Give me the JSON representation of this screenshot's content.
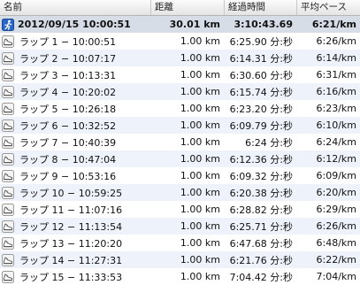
{
  "header": {
    "name": "名前",
    "distance": "距離",
    "elapsed": "経過時間",
    "pace": "平均ペース"
  },
  "summary": {
    "name": "2012/09/15 10:00:51",
    "distance": "30.01 km",
    "time": "3:10:43.69",
    "pace": "6:21/km",
    "icon": "runner-icon"
  },
  "laps": [
    {
      "name": "ラップ 1 − 10:00:51",
      "distance": "1.00 km",
      "time": "6:25.90 分:秒",
      "pace": "6:26/km"
    },
    {
      "name": "ラップ 2 − 10:07:17",
      "distance": "1.00 km",
      "time": "6:14.31 分:秒",
      "pace": "6:14/km"
    },
    {
      "name": "ラップ 3 − 10:13:31",
      "distance": "1.00 km",
      "time": "6:30.60 分:秒",
      "pace": "6:31/km"
    },
    {
      "name": "ラップ 4 − 10:20:02",
      "distance": "1.00 km",
      "time": "6:15.74 分:秒",
      "pace": "6:16/km"
    },
    {
      "name": "ラップ 5 − 10:26:18",
      "distance": "1.00 km",
      "time": "6:23.20 分:秒",
      "pace": "6:23/km"
    },
    {
      "name": "ラップ 6 − 10:32:52",
      "distance": "1.00 km",
      "time": "6:09.79 分:秒",
      "pace": "6:10/km"
    },
    {
      "name": "ラップ 7 − 10:40:39",
      "distance": "1.00 km",
      "time": "6:24 分:秒",
      "pace": "6:24/km"
    },
    {
      "name": "ラップ 8 − 10:47:04",
      "distance": "1.00 km",
      "time": "6:12.36 分:秒",
      "pace": "6:12/km"
    },
    {
      "name": "ラップ 9 − 10:53:16",
      "distance": "1.00 km",
      "time": "6:09.32 分:秒",
      "pace": "6:09/km"
    },
    {
      "name": "ラップ 10 − 10:59:25",
      "distance": "1.00 km",
      "time": "6:20.38 分:秒",
      "pace": "6:20/km"
    },
    {
      "name": "ラップ 11 − 11:07:16",
      "distance": "1.00 km",
      "time": "6:28.82 分:秒",
      "pace": "6:29/km"
    },
    {
      "name": "ラップ 12 − 11:13:54",
      "distance": "1.00 km",
      "time": "6:25.71 分:秒",
      "pace": "6:26/km"
    },
    {
      "name": "ラップ 13 − 11:20:20",
      "distance": "1.00 km",
      "time": "6:47.68 分:秒",
      "pace": "6:48/km"
    },
    {
      "name": "ラップ 14 − 11:27:31",
      "distance": "1.00 km",
      "time": "6:21.76 分:秒",
      "pace": "6:22/km"
    },
    {
      "name": "ラップ 15 − 11:33:53",
      "distance": "1.00 km",
      "time": "7:04.42 分:秒",
      "pace": "7:04/km"
    }
  ],
  "lap_icon": "shoe-icon",
  "colors": {
    "summary_bg": "#d6dde7",
    "alt_row_bg": "#eef3fb",
    "runner_icon_bg": "#2b66c9"
  }
}
